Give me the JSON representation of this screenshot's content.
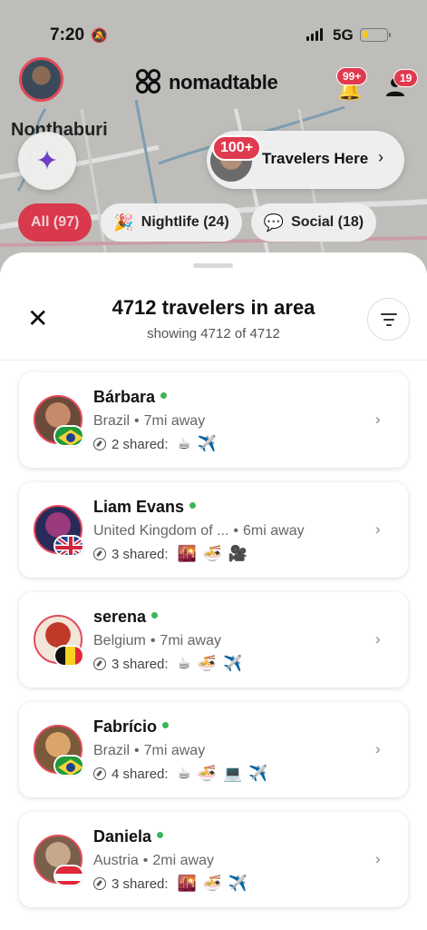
{
  "status_bar": {
    "time": "7:20",
    "network": "5G",
    "battery_level": 0.2
  },
  "header": {
    "brand_name": "nomadtable",
    "notifications_badge": "99+",
    "requests_badge": "19"
  },
  "map": {
    "place_label": "Nonthaburi"
  },
  "travelers_here": {
    "count_badge": "100+",
    "label": "Travelers Here"
  },
  "filters": [
    {
      "label": "All (97)",
      "emoji": "",
      "active": true
    },
    {
      "label": "Nightlife (24)",
      "emoji": "🎉",
      "active": false
    },
    {
      "label": "Social (18)",
      "emoji": "💬",
      "active": false
    }
  ],
  "sheet": {
    "title": "4712 travelers in area",
    "subtitle": "showing 4712 of 4712"
  },
  "travelers": [
    {
      "name": "Bárbara",
      "country": "Brazil",
      "distance": "7mi away",
      "shared": "2 shared:",
      "interests": [
        "☕",
        "✈️"
      ],
      "flag": "brazil",
      "avatar_colors": [
        "#c58a6a",
        "#6b4a3a"
      ]
    },
    {
      "name": "Liam Evans",
      "country": "United Kingdom of ...",
      "distance": "6mi away",
      "shared": "3 shared:",
      "interests": [
        "🌇",
        "🍜",
        "🎥"
      ],
      "flag": "uk",
      "avatar_colors": [
        "#9a3a7a",
        "#2a2a5a"
      ]
    },
    {
      "name": "serena",
      "country": "Belgium",
      "distance": "7mi away",
      "shared": "3 shared:",
      "interests": [
        "☕",
        "🍜",
        "✈️"
      ],
      "flag": "belgium",
      "avatar_colors": [
        "#c03a2a",
        "#f2e6d8"
      ]
    },
    {
      "name": "Fabrício",
      "country": "Brazil",
      "distance": "7mi away",
      "shared": "4 shared:",
      "interests": [
        "☕",
        "🍜",
        "💻",
        "✈️"
      ],
      "flag": "brazil",
      "avatar_colors": [
        "#d9a56a",
        "#7a5a3a"
      ]
    },
    {
      "name": "Daniela",
      "country": "Austria",
      "distance": "2mi away",
      "shared": "3 shared:",
      "interests": [
        "🌇",
        "🍜",
        "✈️"
      ],
      "flag": "austria",
      "avatar_colors": [
        "#c8a88a",
        "#7a5f4a"
      ]
    }
  ]
}
